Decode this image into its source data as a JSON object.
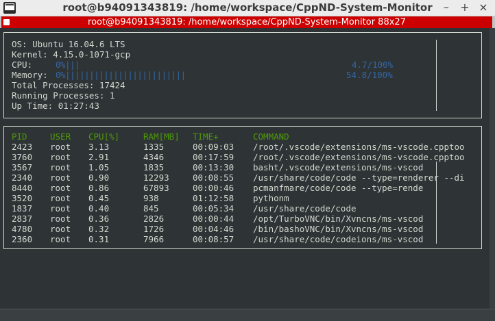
{
  "window": {
    "title": "root@b94091343819: /home/workspace/CppND-System-Monitor",
    "buttons": {
      "minimize": "–",
      "maximize": "+",
      "close": "×"
    }
  },
  "tab": {
    "label": "root@b94091343819: /home/workspace/CppND-System-Monitor 88x27"
  },
  "system": {
    "os_label": "OS: ",
    "os_value": "Ubuntu 16.04.6 LTS",
    "kernel_label": "Kernel: ",
    "kernel_value": "4.15.0-1071-gcp",
    "cpu_label": "CPU: ",
    "cpu_bar": "0%|||",
    "cpu_value": "4.7/100%",
    "cpu_fraction": 0.047,
    "memory_label": "Memory: ",
    "memory_bar": "0%|||||||||||||||||||||||||",
    "memory_value": "54.8/100%",
    "memory_fraction": 0.548,
    "total_processes_label": "Total Processes: ",
    "total_processes_value": "17424",
    "running_processes_label": "Running Processes: ",
    "running_processes_value": "1",
    "uptime_label": "Up Time: ",
    "uptime_value": "01:27:43"
  },
  "processes": {
    "headers": [
      "PID",
      "USER",
      "CPU[%]",
      "RAM[MB]",
      "TIME+",
      "COMMAND"
    ],
    "rows": [
      [
        "2423",
        "root",
        "3.13",
        "1335",
        "00:09:03",
        "/root/.vscode/extensions/ms-vscode.cpptoo"
      ],
      [
        "3760",
        "root",
        "2.91",
        "4346",
        "00:17:59",
        "/root/.vscode/extensions/ms-vscode.cpptoo"
      ],
      [
        "3567",
        "root",
        "1.05",
        "1835",
        "00:13:30",
        "basht/.vscode/extensions/ms-vscod"
      ],
      [
        "2340",
        "root",
        "0.90",
        "12293",
        "00:08:55",
        "/usr/share/code/code --type=renderer --di"
      ],
      [
        "8440",
        "root",
        "0.86",
        "67893",
        "00:00:46",
        "pcmanfmare/code/code --type=rende"
      ],
      [
        "3520",
        "root",
        "0.45",
        "938",
        "01:12:58",
        "pythonm"
      ],
      [
        "1837",
        "root",
        "0.40",
        "845",
        "00:05:34",
        "/usr/share/code/code"
      ],
      [
        "2837",
        "root",
        "0.36",
        "2826",
        "00:00:44",
        "/opt/TurboVNC/bin/Xvncns/ms-vscod"
      ],
      [
        "4780",
        "root",
        "0.32",
        "1726",
        "00:04:46",
        "/bin/bashoVNC/bin/Xvncns/ms-vscod"
      ],
      [
        "2360",
        "root",
        "0.31",
        "7966",
        "00:08:57",
        "/usr/share/code/codeions/ms-vscod"
      ]
    ]
  },
  "colors": {
    "label": "#d3d7cf",
    "meter": "#3465a4",
    "header": "#4e9a06",
    "tab": "#cc0000",
    "background": "#2e3436"
  }
}
